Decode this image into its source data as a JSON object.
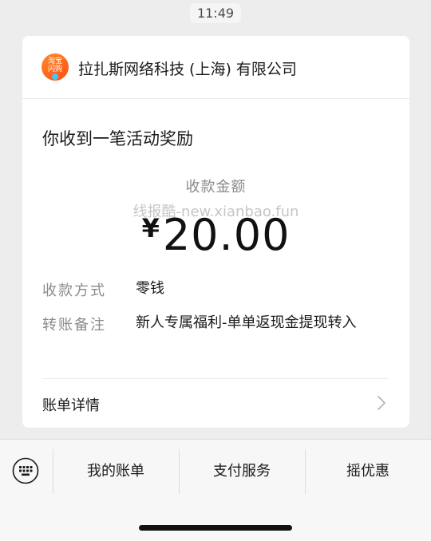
{
  "status": {
    "time": "11:49"
  },
  "header": {
    "logo_line1": "淘宝",
    "logo_line2": "闪购",
    "merchant_name": "拉扎斯网络科技 (上海) 有限公司"
  },
  "notice": {
    "title": "你收到一笔活动奖励",
    "amount_label": "收款金额",
    "watermark": "线报酷-new.xianbao.fun",
    "currency": "¥",
    "amount": "20.00"
  },
  "details": [
    {
      "label": "收款方式",
      "value": "零钱"
    },
    {
      "label": "转账备注",
      "value": "新人专属福利-单单返现金提现转入"
    }
  ],
  "bill_detail": {
    "label": "账单详情"
  },
  "menu": {
    "items": [
      "我的账单",
      "支付服务",
      "摇优惠"
    ]
  },
  "colors": {
    "background": "#ededed",
    "logo_orange": "#ff5a1a",
    "label_gray": "#8a8a8a"
  },
  "icons": {
    "keyboard": "keyboard-icon",
    "chevron": "chevron-right-icon"
  }
}
